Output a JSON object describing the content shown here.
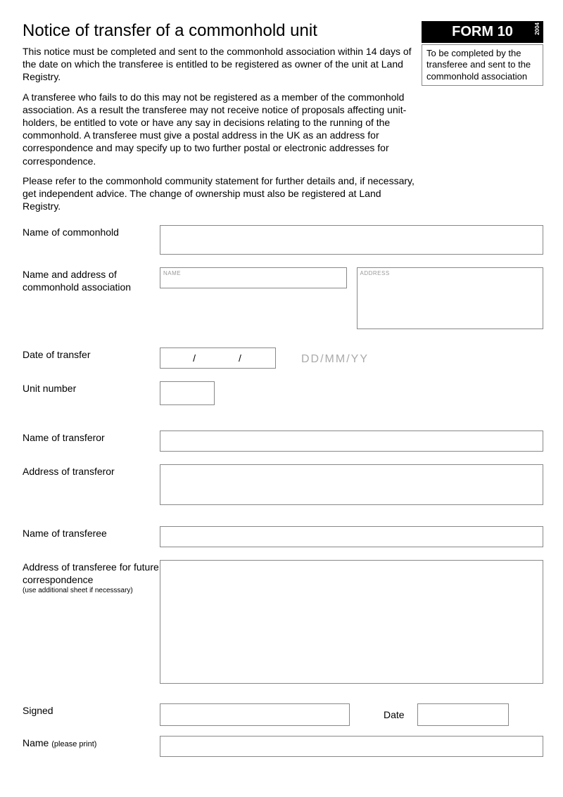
{
  "header": {
    "title": "Notice of transfer of a commonhold unit",
    "form_label": "FORM 10",
    "form_year": "2004",
    "side_note": "To be completed by the transferee and sent to the commonhold association"
  },
  "intro": {
    "p1": "This notice must be completed and sent to the commonhold association within 14 days of the date on which the transferee is entitled to be registered as owner of the unit at Land Registry.",
    "p2": "A transferee who fails to do this may not be registered as a member of the commonhold association. As a result the transferee may not receive notice of proposals affecting unit-holders, be entitled to vote or have any say in decisions relating to the running of the commonhold. A transferee must give a postal address in the UK as an address for correspondence and may specify up to two further postal or electronic addresses for correspondence.",
    "p3": "Please refer to the commonhold community statement for further details and, if necessary, get independent advice. The change of ownership must also be registered at Land Registry."
  },
  "fields": {
    "name_commonhold": "Name of commonhold",
    "name_addr_assoc": "Name and address of commonhold association",
    "inner_name": "NAME",
    "inner_address": "ADDRESS",
    "date_transfer": "Date of transfer",
    "date_sep": "/          /",
    "date_hint": "DD/MM/YY",
    "unit_number": "Unit number",
    "name_transferor": "Name of transferor",
    "addr_transferor": "Address of transferor",
    "name_transferee": "Name of transferee",
    "addr_transferee": "Address of transferee for future correspondence",
    "addr_transferee_sub": "(use additional sheet if necesssary)",
    "signed": "Signed",
    "date": "Date",
    "name_print": "Name",
    "name_print_sub": "(please print)"
  }
}
